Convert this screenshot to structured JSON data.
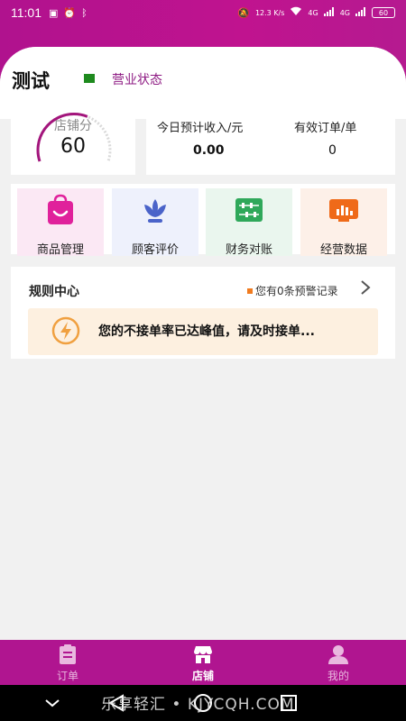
{
  "status_bar": {
    "time": "11:01",
    "network": "12.3 K/s",
    "signal_a": "4G",
    "signal_b": "4G",
    "battery": "60"
  },
  "store": {
    "name": "测试",
    "status_label": "营业状态",
    "status_color": "#1e8a1e"
  },
  "score": {
    "label": "店铺分",
    "value": "60"
  },
  "stats": {
    "income_label": "今日预计收入/元",
    "income_value": "0.00",
    "orders_label": "有效订单/单",
    "orders_value": "0"
  },
  "actions": [
    {
      "label": "商品管理",
      "icon": "shopping-bag-icon",
      "bg": "#fbe8f4"
    },
    {
      "label": "顾客评价",
      "icon": "lotus-icon",
      "bg": "#eef1fc"
    },
    {
      "label": "财务对账",
      "icon": "abacus-icon",
      "bg": "#eaf6ee"
    },
    {
      "label": "经营数据",
      "icon": "bar-chart-icon",
      "bg": "#fdf0e8"
    }
  ],
  "rules": {
    "title": "规则中心",
    "link": "您有0条预警记录",
    "alert": "您的不接单率已达峰值，请及时接单..."
  },
  "tabs": [
    {
      "label": "订单",
      "icon": "clipboard-icon",
      "active": false
    },
    {
      "label": "店铺",
      "icon": "store-icon",
      "active": true
    },
    {
      "label": "我的",
      "icon": "user-icon",
      "active": false
    }
  ],
  "watermark": "乐享轻汇 • KJYCQH.COM",
  "colors": {
    "brand": "#b01590",
    "accent": "#8e1b83",
    "warning": "#f07b1f"
  }
}
